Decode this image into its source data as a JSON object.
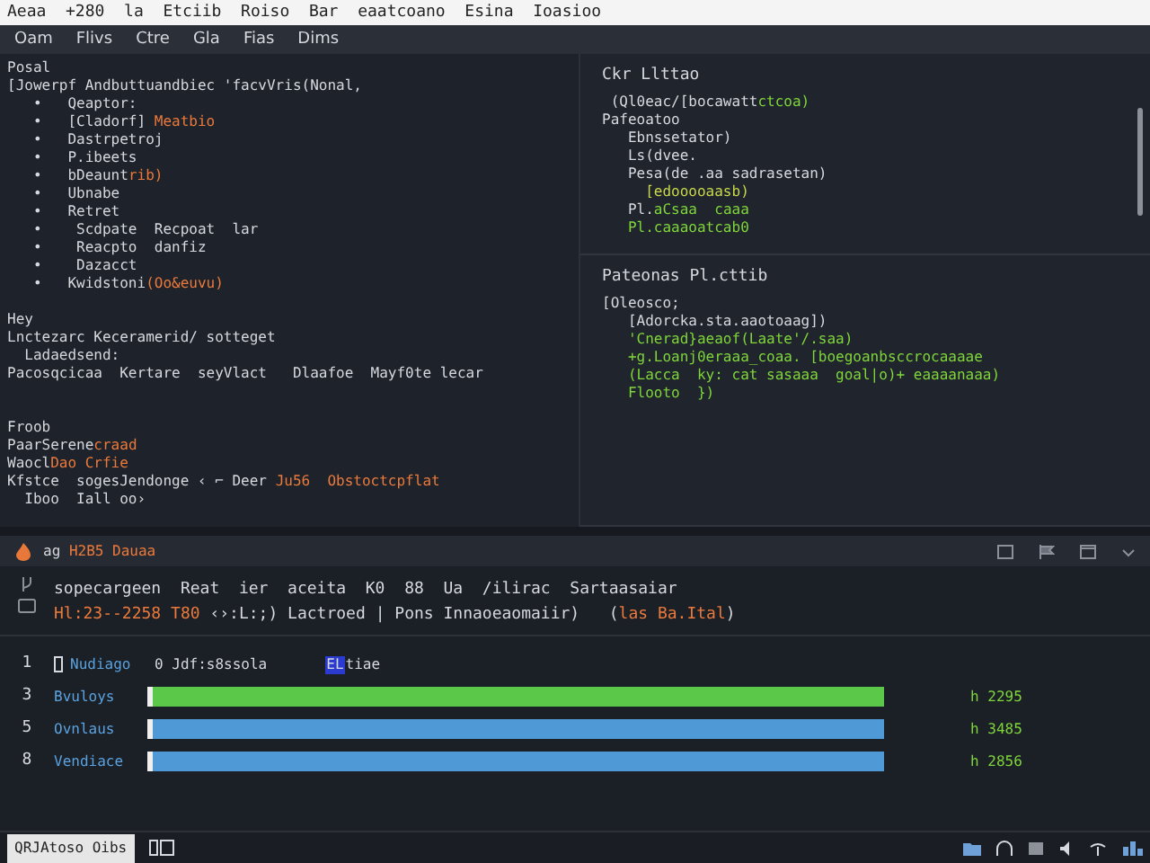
{
  "window": {
    "title": "Aeaa  +280  la  Etciib  Roiso  Bar  eaatcoano  Esina  Ioasioo"
  },
  "menu": [
    "Oam",
    "Flivs",
    "Ctre",
    "Gla",
    "Fias",
    "Dims"
  ],
  "editor": {
    "lines": [
      {
        "kind": "code",
        "segs": [
          {
            "text": "Posal",
            "kind": "plain"
          }
        ]
      },
      {
        "kind": "code",
        "segs": [
          {
            "text": "[Jowerpf Andbuttuandbiec 'facvVris(Nonal,",
            "kind": "plain"
          }
        ]
      },
      {
        "kind": "code",
        "segs": [
          {
            "text": "   •   Qeaptor:",
            "kind": "plain"
          }
        ]
      },
      {
        "kind": "code",
        "segs": [
          {
            "text": "   •   [Cladorf] ",
            "kind": "plain"
          },
          {
            "text": "Meatbio",
            "kind": "orange"
          }
        ]
      },
      {
        "kind": "code",
        "segs": [
          {
            "text": "   •   Dastrpetroj",
            "kind": "plain"
          }
        ]
      },
      {
        "kind": "code",
        "segs": [
          {
            "text": "   •   P.ibeets",
            "kind": "plain"
          }
        ]
      },
      {
        "kind": "code",
        "segs": [
          {
            "text": "   •   bDeaunt",
            "kind": "plain"
          },
          {
            "text": "rib)",
            "kind": "orange"
          }
        ]
      },
      {
        "kind": "code",
        "segs": [
          {
            "text": "   •   Ubnabe",
            "kind": "plain"
          }
        ]
      },
      {
        "kind": "code",
        "segs": [
          {
            "text": "   •   Retret",
            "kind": "plain"
          }
        ]
      },
      {
        "kind": "code",
        "segs": [
          {
            "text": "   •    Scdpate  Recpoat  lar",
            "kind": "plain"
          }
        ]
      },
      {
        "kind": "code",
        "segs": [
          {
            "text": "   •    Reacpto  danfiz",
            "kind": "plain"
          }
        ]
      },
      {
        "kind": "code",
        "segs": [
          {
            "text": "   •    Dazacct",
            "kind": "plain"
          }
        ]
      },
      {
        "kind": "code",
        "segs": [
          {
            "text": "   •   Kwidstoni",
            "kind": "plain"
          },
          {
            "text": "(Oo&euvu)",
            "kind": "orange"
          }
        ]
      },
      {
        "kind": "blank"
      },
      {
        "kind": "code",
        "segs": [
          {
            "text": "Hey",
            "kind": "plain"
          }
        ]
      },
      {
        "kind": "code",
        "segs": [
          {
            "text": "Lnctezarc Keceramerid/ sotteget",
            "kind": "plain"
          }
        ]
      },
      {
        "kind": "code",
        "segs": [
          {
            "text": "  Ladaedsend:",
            "kind": "plain"
          }
        ]
      },
      {
        "kind": "code",
        "segs": [
          {
            "text": "Pacosqcicaa  Kertare  seyVlact   Dlaafoe  Mayf0te lecar",
            "kind": "plain"
          }
        ]
      },
      {
        "kind": "blank"
      },
      {
        "kind": "blank"
      },
      {
        "kind": "code",
        "segs": [
          {
            "text": "Froob",
            "kind": "plain"
          }
        ]
      },
      {
        "kind": "code",
        "segs": [
          {
            "text": "PaarSerene",
            "kind": "plain"
          },
          {
            "text": "craad",
            "kind": "orange"
          }
        ]
      },
      {
        "kind": "code",
        "segs": [
          {
            "text": "Waocl",
            "kind": "plain"
          },
          {
            "text": "Dao Crfie",
            "kind": "orange"
          }
        ]
      },
      {
        "kind": "code",
        "segs": [
          {
            "text": "Kfstce  sogesJendonge ‹ ⌐ Deer ",
            "kind": "plain"
          },
          {
            "text": "Ju56  Obstoctcpflat",
            "kind": "orange"
          }
        ]
      },
      {
        "kind": "code",
        "segs": [
          {
            "text": "  Iboo  Iall oo›",
            "kind": "plain"
          }
        ]
      }
    ]
  },
  "panels": [
    {
      "title": "Ckr Llttao",
      "lines": [
        {
          "kind": "code",
          "segs": [
            {
              "text": " (Ql0eac/[bocawatt",
              "kind": "plain"
            },
            {
              "text": "ctcoa)",
              "kind": "green"
            }
          ]
        },
        {
          "kind": "code",
          "segs": [
            {
              "text": "Pafeoatoo",
              "kind": "plain"
            }
          ]
        },
        {
          "kind": "code",
          "segs": [
            {
              "text": "   Ebnssetator)",
              "kind": "plain"
            }
          ]
        },
        {
          "kind": "code",
          "segs": [
            {
              "text": "   Ls(dvee.",
              "kind": "plain"
            }
          ]
        },
        {
          "kind": "code",
          "segs": [
            {
              "text": "   Pesa(de .aa sadrasetan)",
              "kind": "plain"
            }
          ]
        },
        {
          "kind": "code",
          "segs": [
            {
              "text": "     [edooooaasb)",
              "kind": "yellow"
            }
          ]
        },
        {
          "kind": "code",
          "segs": [
            {
              "text": "   Pl.",
              "kind": "plain"
            },
            {
              "text": "aCsaa  caaa",
              "kind": "green"
            }
          ]
        },
        {
          "kind": "code",
          "segs": [
            {
              "text": "   Pl.caaaoatcab0",
              "kind": "green"
            }
          ]
        }
      ]
    },
    {
      "title": "Pateonas Pl.cttib",
      "lines": [
        {
          "kind": "code",
          "segs": [
            {
              "text": "[Oleosco;",
              "kind": "plain"
            }
          ]
        },
        {
          "kind": "code",
          "segs": [
            {
              "text": "   [Adorcka.sta.aaotoaag])",
              "kind": "plain"
            }
          ]
        },
        {
          "kind": "code",
          "segs": [
            {
              "text": "   'Cnerad}aeaof(Laate'/.saa)",
              "kind": "green"
            }
          ]
        },
        {
          "kind": "code",
          "segs": [
            {
              "text": "   +g.Loanj0eraaa_coaa. [boegoanbsccrocaaaae",
              "kind": "green"
            }
          ]
        },
        {
          "kind": "code",
          "segs": [
            {
              "text": "   (Lacca  ky: cat sasaaa  goal|o)+ eaaaanaaa)",
              "kind": "green"
            }
          ]
        },
        {
          "kind": "code",
          "segs": [
            {
              "text": "   Flooto  })",
              "kind": "green"
            }
          ]
        }
      ]
    }
  ],
  "bottom_panel": {
    "title_prefix": "ag",
    "title": "H2B5 Dauaa",
    "lines": [
      {
        "kind": "code",
        "segs": [
          {
            "text": "sopecargeen  Reat  ier  aceita  K0  88  Ua  /ilirac  Sartaasaiar",
            "kind": "plain"
          }
        ]
      },
      {
        "kind": "code",
        "segs": [
          {
            "text": "Hl:23--2258 T80 ",
            "kind": "orange"
          },
          {
            "text": "‹›:L:;) Lactroed | Pons Innaoeaomaiir)   (",
            "kind": "plain"
          },
          {
            "text": "las Ba.Ital",
            "kind": "orange"
          },
          {
            "text": ")",
            "kind": "plain"
          }
        ]
      }
    ],
    "header_row": {
      "number": "1",
      "label": "Nudiago",
      "text": "0 Jdf:s8ssola",
      "tag": "EL",
      "tag_text": "tiae"
    },
    "rows": [
      {
        "number": "3",
        "label": "Bvuloys",
        "level": 0.99,
        "color": "#5cc84a",
        "reading": "h 2295"
      },
      {
        "number": "5",
        "label": "Ovnlaus",
        "level": 0.99,
        "color": "#4f9ad6",
        "reading": "h 3485"
      },
      {
        "number": "8",
        "label": "Vendiace",
        "level": 0.99,
        "color": "#4f9ad6",
        "reading": "h 2856"
      }
    ]
  },
  "taskbar": {
    "start_label": "QRJAtoso Oibs"
  }
}
